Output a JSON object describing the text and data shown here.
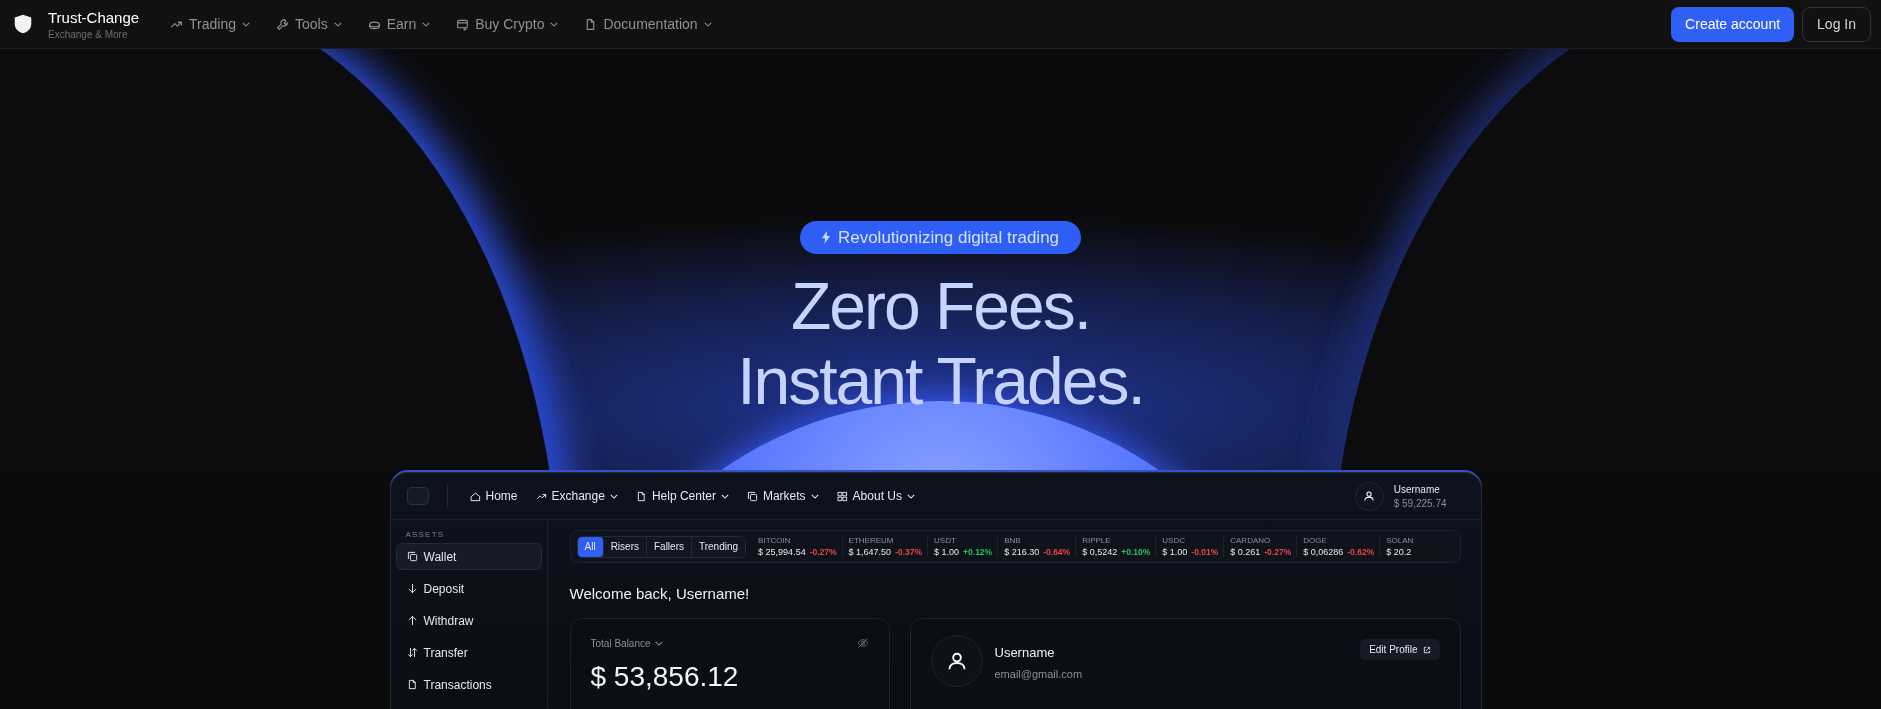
{
  "nav": {
    "brand": {
      "name": "Trust-Change",
      "tagline": "Exchange & More"
    },
    "items": [
      {
        "label": "Trading",
        "kind": "trend"
      },
      {
        "label": "Tools",
        "kind": "wrench"
      },
      {
        "label": "Earn",
        "kind": "coin"
      },
      {
        "label": "Buy Crypto",
        "kind": "card"
      },
      {
        "label": "Documentation",
        "kind": "doc"
      }
    ],
    "buttons": [
      {
        "label": "Create account",
        "kind": "primary"
      },
      {
        "label": "Log In",
        "kind": "outline"
      }
    ]
  },
  "hero": {
    "badge": "Revolutionizing digital trading",
    "headline": [
      "Zero Fees.",
      "Instant Trades."
    ]
  },
  "app": {
    "nav": [
      {
        "label": "Home",
        "kind": "home",
        "dropdown": false
      },
      {
        "label": "Exchange",
        "kind": "trend",
        "dropdown": true
      },
      {
        "label": "Help Center",
        "kind": "doc",
        "dropdown": true
      },
      {
        "label": "Markets",
        "kind": "copy",
        "dropdown": true
      },
      {
        "label": "About Us",
        "kind": "grid",
        "dropdown": true
      }
    ],
    "user": {
      "name": "Username",
      "balance": "$ 59,225.74"
    },
    "sidebar": {
      "section": "ASSETS",
      "items": [
        {
          "label": "Wallet",
          "kind": "copy",
          "selected": true
        },
        {
          "label": "Deposit",
          "kind": "down",
          "selected": false
        },
        {
          "label": "Withdraw",
          "kind": "up",
          "selected": false
        },
        {
          "label": "Transfer",
          "kind": "swap",
          "selected": false
        },
        {
          "label": "Transactions",
          "kind": "doc",
          "selected": false
        }
      ]
    },
    "filters": [
      {
        "label": "All",
        "selected": true
      },
      {
        "label": "Risers",
        "selected": false
      },
      {
        "label": "Fallers",
        "selected": false
      },
      {
        "label": "Trending",
        "selected": false
      }
    ],
    "tickers": [
      {
        "name": "BITCOIN",
        "price": "$ 25,994.54",
        "change": "-0.27%",
        "color": "#ef4444"
      },
      {
        "name": "ETHEREUM",
        "price": "$ 1,647.50",
        "change": "-0.37%",
        "color": "#ef4444"
      },
      {
        "name": "USDT",
        "price": "$ 1.00",
        "change": "+0.12%",
        "color": "#22c55e"
      },
      {
        "name": "BNB",
        "price": "$ 216.30",
        "change": "-0.64%",
        "color": "#ef4444"
      },
      {
        "name": "RIPPLE",
        "price": "$ 0,5242",
        "change": "+0.10%",
        "color": "#22c55e"
      },
      {
        "name": "USDC",
        "price": "$ 1.00",
        "change": "-0.01%",
        "color": "#ef4444"
      },
      {
        "name": "CARDANO",
        "price": "$ 0.261",
        "change": "-0.27%",
        "color": "#ef4444"
      },
      {
        "name": "DOGE",
        "price": "$ 0,06286",
        "change": "-0.62%",
        "color": "#ef4444"
      },
      {
        "name": "SOLAN",
        "price": "$ 20.2"
      }
    ],
    "welcome": "Welcome back, Username!",
    "balance_card": {
      "label": "Total Balance",
      "amount": "$ 53,856.12"
    },
    "profile": {
      "name": "Username",
      "email": "email@gmail.com",
      "button": "Edit Profile"
    }
  }
}
